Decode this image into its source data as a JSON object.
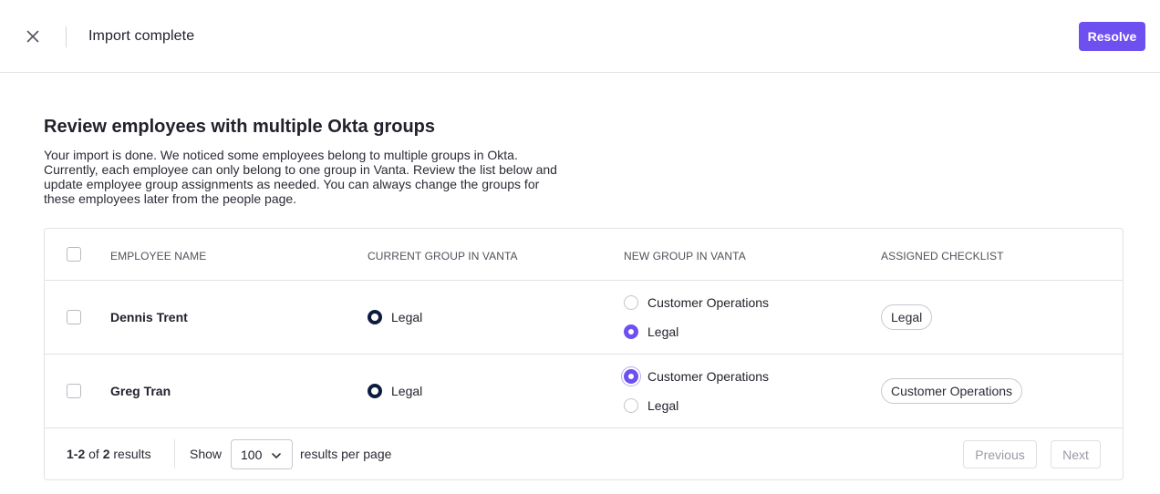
{
  "header": {
    "close_icon": "close-icon",
    "title": "Import complete",
    "resolve_label": "Resolve",
    "accent": "#6e4ff0"
  },
  "main": {
    "heading": "Review employees with multiple Okta groups",
    "description": "Your import is done. We noticed some employees belong to multiple groups in Okta. Currently, each employee can only belong to one group in Vanta. Review the list below and update employee group assignments as needed. You can always change the groups for these employees later from the people page."
  },
  "table": {
    "columns": [
      "EMPLOYEE NAME",
      "CURRENT GROUP IN VANTA",
      "NEW GROUP IN VANTA",
      "ASSIGNED CHECKLIST"
    ],
    "rows": [
      {
        "name": "Dennis Trent",
        "current_group": "Legal",
        "new_group_options": [
          "Customer Operations",
          "Legal"
        ],
        "new_group_selected": "Legal",
        "checklist": "Legal"
      },
      {
        "name": "Greg Tran",
        "current_group": "Legal",
        "new_group_options": [
          "Customer Operations",
          "Legal"
        ],
        "new_group_selected": "Customer Operations",
        "checklist": "Customer Operations"
      }
    ]
  },
  "pagination": {
    "range": "1-2",
    "of": "of",
    "total": "2",
    "results_word": "results",
    "show_label": "Show",
    "page_size": "100",
    "per_page_label": "results per page",
    "previous_label": "Previous",
    "next_label": "Next"
  }
}
